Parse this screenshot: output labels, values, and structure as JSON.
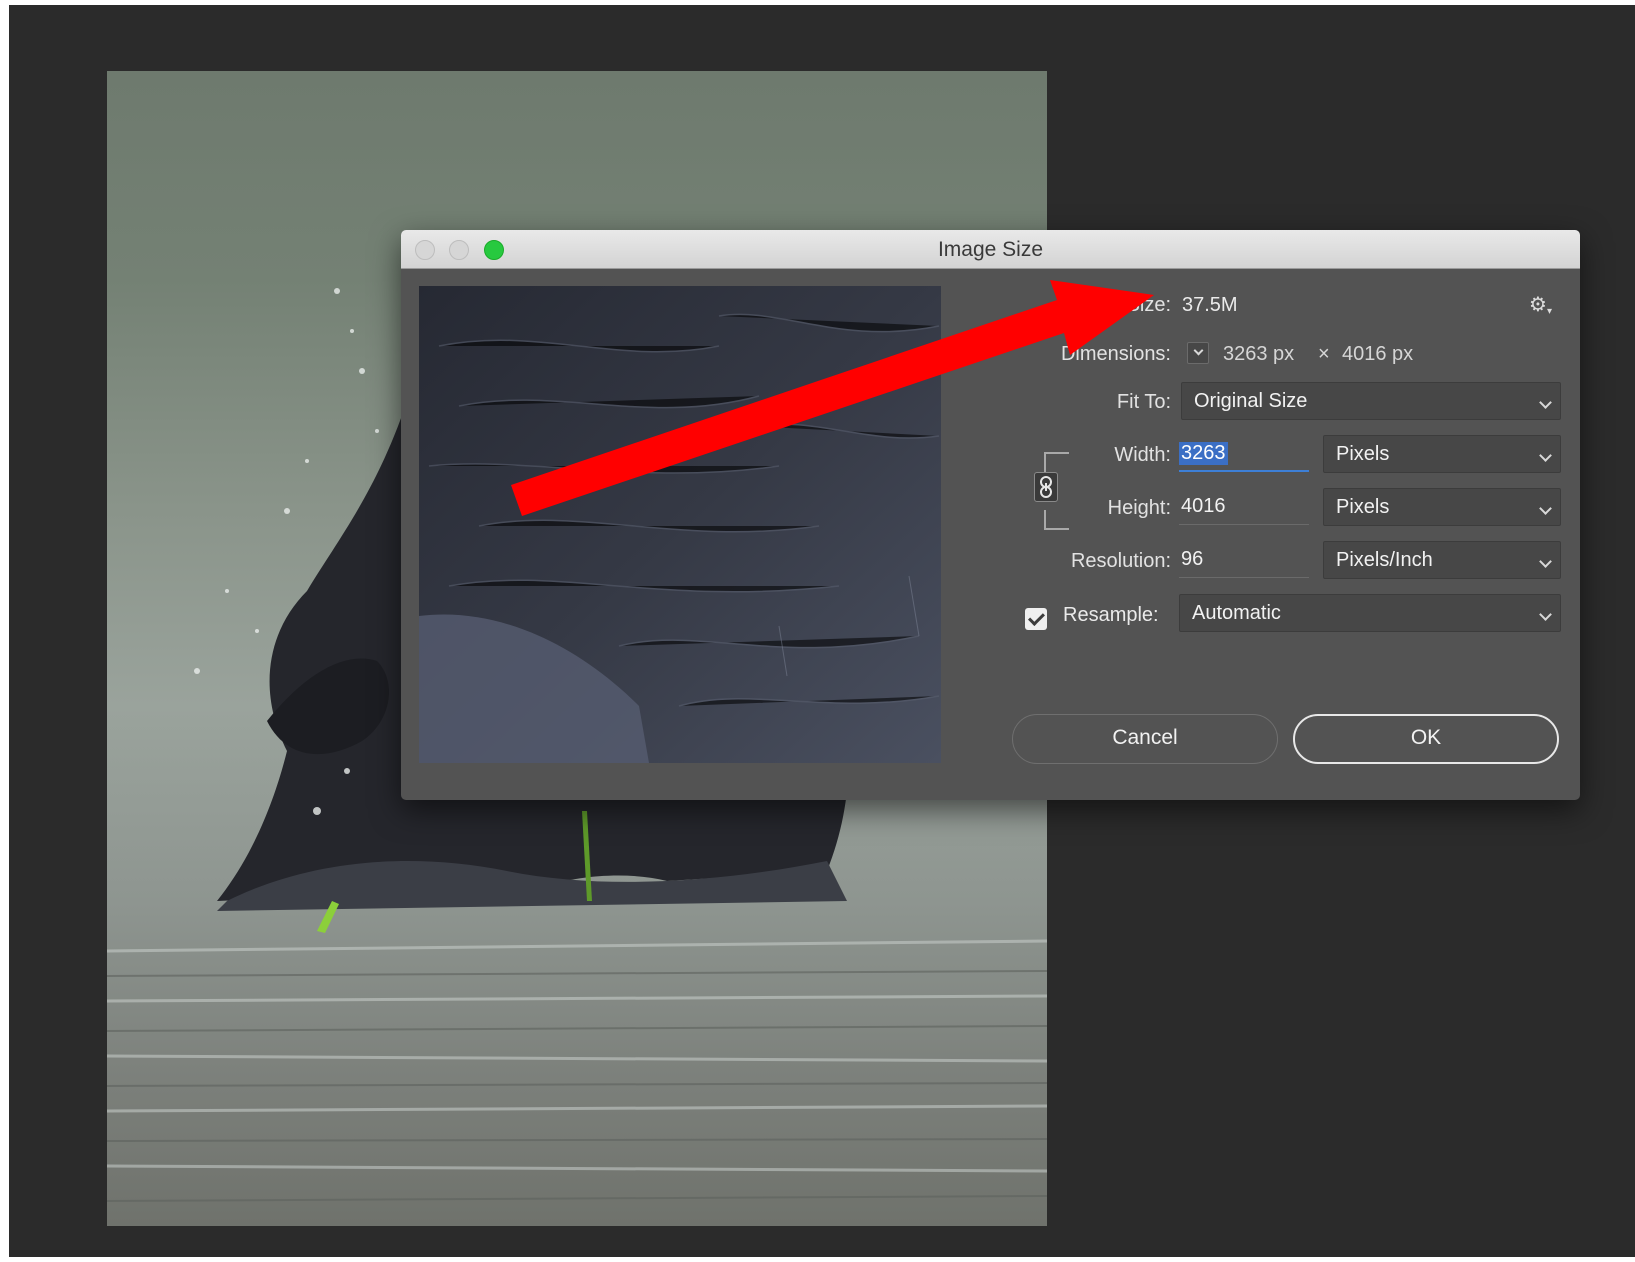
{
  "dialog": {
    "title": "Image Size",
    "image_size_label": "Image Size:",
    "image_size_value": "37.5M",
    "dimensions_label": "Dimensions:",
    "dimensions_width": "3263 px",
    "dimensions_times": "×",
    "dimensions_height": "4016 px",
    "fit_to_label": "Fit To:",
    "fit_to_value": "Original Size",
    "width_label": "Width:",
    "width_value": "3263",
    "width_unit": "Pixels",
    "height_label": "Height:",
    "height_value": "4016",
    "height_unit": "Pixels",
    "resolution_label": "Resolution:",
    "resolution_value": "96",
    "resolution_unit": "Pixels/Inch",
    "resample_label": "Resample:",
    "resample_value": "Automatic",
    "resample_checked": true,
    "cancel_label": "Cancel",
    "ok_label": "OK",
    "gear_icon": "gear-icon"
  },
  "colors": {
    "canvas_bg": "#2b2b2b",
    "dialog_bg": "#535353",
    "annotation_arrow": "#ff0000",
    "selection_blue": "#3b6fc5",
    "zoom_button": "#27c93f"
  }
}
